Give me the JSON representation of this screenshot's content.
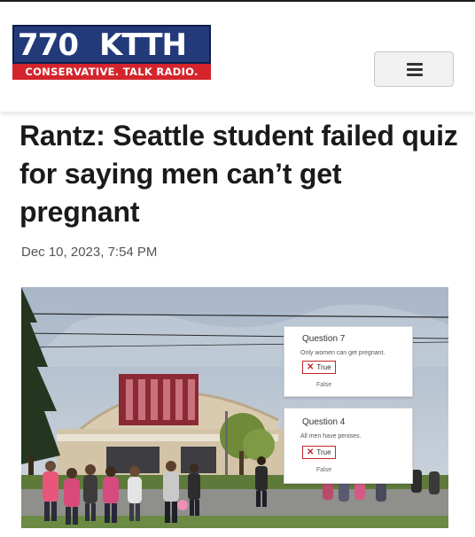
{
  "site": {
    "logo_number": "770",
    "logo_call": "KTTH",
    "logo_tagline": "CONSERVATIVE. TALK RADIO."
  },
  "article": {
    "headline": "Rantz: Seattle student failed quiz for saying men can’t get pregnant",
    "date": "Dec 10, 2023, 7:54 PM"
  },
  "quiz": [
    {
      "title": "Question 7",
      "text": "Only women can get pregnant.",
      "selected": "True",
      "other": "False"
    },
    {
      "title": "Question 4",
      "text": "All men have penises.",
      "selected": "True",
      "other": "False"
    }
  ],
  "icons": {
    "menu": "hamburger-menu-icon",
    "wrong": "x-mark-icon"
  },
  "colors": {
    "brand_blue": "#233a7a",
    "brand_red": "#d4242c",
    "wrong_red": "#c0272d"
  }
}
